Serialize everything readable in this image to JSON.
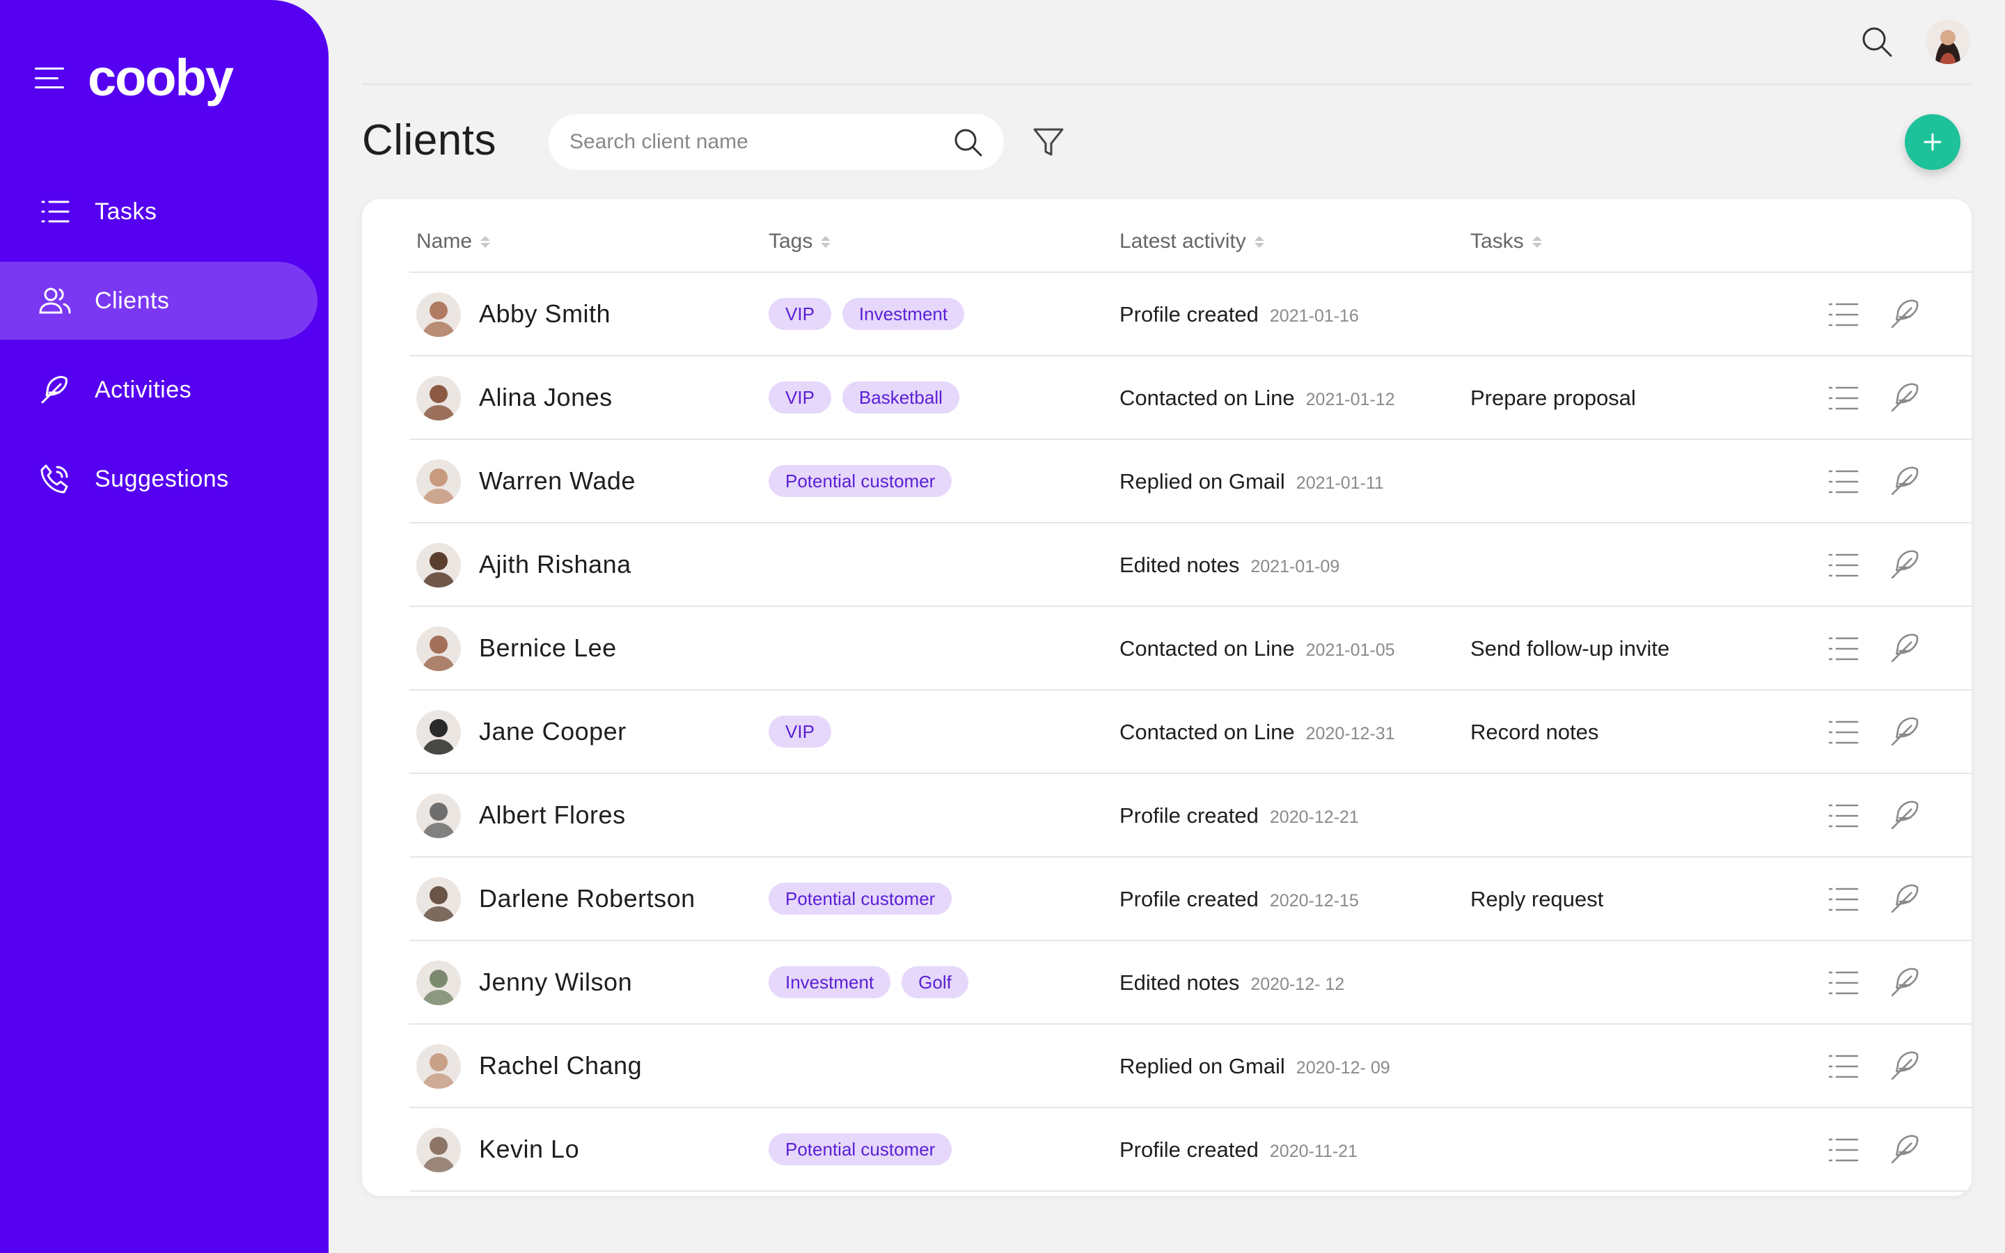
{
  "app": {
    "brand": "cooby"
  },
  "sidebar": {
    "items": [
      {
        "label": "Tasks",
        "icon": "list-icon",
        "active": false
      },
      {
        "label": "Clients",
        "icon": "users-icon",
        "active": true
      },
      {
        "label": "Activities",
        "icon": "feather-icon",
        "active": false
      },
      {
        "label": "Suggestions",
        "icon": "phone-call-icon",
        "active": false
      }
    ]
  },
  "page": {
    "title": "Clients"
  },
  "search": {
    "placeholder": "Search client name",
    "value": ""
  },
  "table": {
    "columns": [
      "Name",
      "Tags",
      "Latest activity",
      "Tasks"
    ],
    "rows": [
      {
        "name": "Abby Smith",
        "tags": [
          "VIP",
          "Investment"
        ],
        "activity": "Profile created",
        "date": "2021-01-16",
        "task": "",
        "avatar_color": "#b07b62"
      },
      {
        "name": "Alina Jones",
        "tags": [
          "VIP",
          "Basketball"
        ],
        "activity": "Contacted on Line",
        "date": "2021-01-12",
        "task": "Prepare proposal",
        "avatar_color": "#8c5a44"
      },
      {
        "name": "Warren Wade",
        "tags": [
          "Potential customer"
        ],
        "activity": "Replied on Gmail",
        "date": "2021-01-11",
        "task": "",
        "avatar_color": "#c89a80"
      },
      {
        "name": "Ajith Rishana",
        "tags": [],
        "activity": "Edited notes",
        "date": "2021-01-09",
        "task": "",
        "avatar_color": "#5a3e2e"
      },
      {
        "name": "Bernice Lee",
        "tags": [],
        "activity": "Contacted on Line",
        "date": "2021-01-05",
        "task": "Send follow-up invite",
        "avatar_color": "#a27058"
      },
      {
        "name": "Jane Cooper",
        "tags": [
          "VIP"
        ],
        "activity": "Contacted on Line",
        "date": "2020-12-31",
        "task": "Record notes",
        "avatar_color": "#2a2a2a"
      },
      {
        "name": "Albert Flores",
        "tags": [],
        "activity": "Profile created",
        "date": "2020-12-21",
        "task": "",
        "avatar_color": "#6e6e6e"
      },
      {
        "name": "Darlene Robertson",
        "tags": [
          "Potential customer"
        ],
        "activity": "Profile created",
        "date": "2020-12-15",
        "task": "Reply request",
        "avatar_color": "#6a5446"
      },
      {
        "name": "Jenny Wilson",
        "tags": [
          "Investment",
          "Golf"
        ],
        "activity": "Edited notes",
        "date": "2020-12- 12",
        "task": "",
        "avatar_color": "#7b8a6e"
      },
      {
        "name": "Rachel Chang",
        "tags": [],
        "activity": "Replied on Gmail",
        "date": "2020-12- 09",
        "task": "",
        "avatar_color": "#c9a088"
      },
      {
        "name": "Kevin Lo",
        "tags": [
          "Potential customer"
        ],
        "activity": "Profile created",
        "date": "2020-11-21",
        "task": "",
        "avatar_color": "#8d7566"
      }
    ]
  },
  "colors": {
    "sidebar": "#5500f0",
    "accent_green": "#1dc29a",
    "tag_bg": "#e6d8fb",
    "tag_text": "#5a1fd6"
  }
}
